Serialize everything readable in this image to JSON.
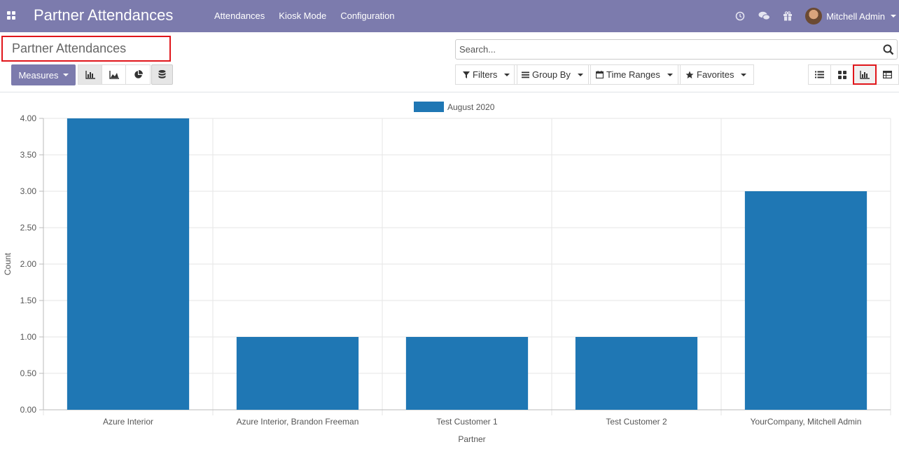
{
  "navbar": {
    "app_title": "Partner Attendances",
    "menu": [
      "Attendances",
      "Kiosk Mode",
      "Configuration"
    ],
    "user_name": "Mitchell Admin",
    "color": "#7c7bad"
  },
  "control_panel": {
    "breadcrumb": "Partner Attendances",
    "search_placeholder": "Search...",
    "measures_label": "Measures",
    "filters_label": "Filters",
    "groupby_label": "Group By",
    "timeranges_label": "Time Ranges",
    "favorites_label": "Favorites"
  },
  "icons": {
    "apps": "apps-grid-icon",
    "search": "search-icon",
    "views": [
      "list-view-icon",
      "kanban-view-icon",
      "graph-view-icon",
      "pivot-view-icon"
    ]
  },
  "chart_data": {
    "type": "bar",
    "categories": [
      "Azure Interior",
      "Azure Interior, Brandon Freeman",
      "Test Customer 1",
      "Test Customer 2",
      "YourCompany, Mitchell Admin"
    ],
    "series": [
      {
        "name": "August 2020",
        "values": [
          4,
          1,
          1,
          1,
          3
        ],
        "color": "#1f77b4"
      }
    ],
    "ylabel": "Count",
    "xlabel": "Partner",
    "ylim": [
      0,
      4
    ],
    "yticks": [
      "0.00",
      "0.50",
      "1.00",
      "1.50",
      "2.00",
      "2.50",
      "3.00",
      "3.50",
      "4.00"
    ],
    "legend": "top-center",
    "grid": true
  }
}
